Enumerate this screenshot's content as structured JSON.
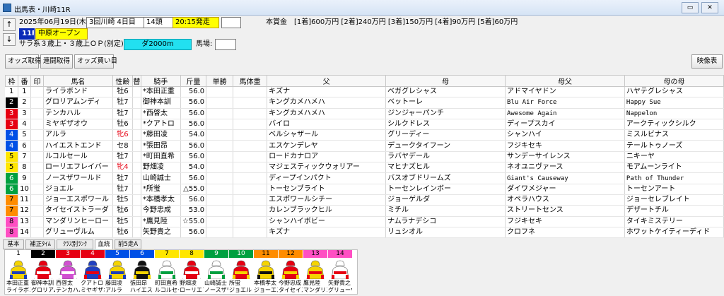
{
  "window": {
    "title": "出馬表・川崎11R",
    "minimize_label": "▭",
    "close_label": "✕"
  },
  "race": {
    "date": "2025年06月19日(木)",
    "meeting": "3回川崎 4日目",
    "runners": "14頭",
    "post_time": "20:15発走",
    "race_no": "11R",
    "race_name": "中原オープン",
    "conditions": "サラ系３歳上・３歳上ＯＰ(別定)",
    "course": "ダ2000m",
    "ground_label": "馬場:",
    "prize_label": "本賞金",
    "prizes": "[1着]600万円 [2着]240万円 [3着]150万円 [4着]90万円 [5着]60万円"
  },
  "toolbar": {
    "odds_fetch": "オッズ取得",
    "renraku_fetch": "連闘取得",
    "odds_buy": "オッズ買い目",
    "video": "映像表"
  },
  "table": {
    "headers": [
      "枠",
      "番",
      "印",
      "馬名",
      "性齢",
      "替",
      "騎手",
      "斤量",
      "単勝",
      "馬体重",
      "父",
      "母",
      "母父",
      "母の母"
    ],
    "rows": [
      {
        "waku": "1",
        "num": "1",
        "name": "ライラボンド",
        "sexage": "牡6",
        "change": "",
        "jockey": "*本田正重",
        "weight": "56.0",
        "sire": "キズナ",
        "dam": "ベガグレシャス",
        "damsire": "アドマイヤドン",
        "damdam": "ハヤテグレシャス"
      },
      {
        "waku": "2",
        "num": "2",
        "name": "グロリアムンディ",
        "sexage": "牡7",
        "change": "",
        "jockey": "御神本訓",
        "weight": "56.0",
        "sire": "キングカメハメハ",
        "dam": "ベットーレ",
        "damsire": "Blu Air Force",
        "damdam": "Happy Sue"
      },
      {
        "waku": "3",
        "num": "3",
        "name": "テンカハル",
        "sexage": "牡7",
        "change": "",
        "jockey": "*西啓太",
        "weight": "56.0",
        "sire": "キングカメハメハ",
        "dam": "ジンジャーパンチ",
        "damsire": "Awesome Again",
        "damdam": "Nappelon"
      },
      {
        "waku": "3",
        "num": "4",
        "name": "ミヤギザオウ",
        "sexage": "牡6",
        "change": "",
        "jockey": "*クアトロ",
        "weight": "56.0",
        "sire": "バイロ",
        "dam": "シルクドレス",
        "damsire": "ディープスカイ",
        "damdam": "アークティックシルク"
      },
      {
        "waku": "4",
        "num": "5",
        "name": "アルラ",
        "sexage": "牝6",
        "change": "",
        "jockey": "*藤田凌",
        "weight": "54.0",
        "sire": "ベルシャザール",
        "dam": "グリーディー",
        "damsire": "シャンハイ",
        "damdam": "ミスルビナス"
      },
      {
        "waku": "4",
        "num": "6",
        "name": "ハイエストエンド",
        "sexage": "セ8",
        "change": "",
        "jockey": "*張田昂",
        "weight": "56.0",
        "sire": "エスケンデレヤ",
        "dam": "デュークタイフーン",
        "damsire": "フジキセキ",
        "damdam": "テールトゥノーズ"
      },
      {
        "waku": "5",
        "num": "7",
        "name": "ルコルセール",
        "sexage": "牡7",
        "change": "",
        "jockey": "*町田直希",
        "weight": "56.0",
        "sire": "ロードカナロア",
        "dam": "ラバヤデール",
        "damsire": "サンデーサイレンス",
        "damdam": "ニキーヤ"
      },
      {
        "waku": "5",
        "num": "8",
        "name": "ローリエフレイバー",
        "sexage": "牝4",
        "change": "",
        "jockey": "野畑凌",
        "weight": "54.0",
        "sire": "マジェスティックウォリアー",
        "dam": "マヒナズヒル",
        "damsire": "ネオユニヴァース",
        "damdam": "モアムーンライト"
      },
      {
        "waku": "6",
        "num": "9",
        "name": "ノースザワールド",
        "sexage": "牡7",
        "change": "",
        "jockey": "山崎誠士",
        "weight": "56.0",
        "sire": "ディープインパクト",
        "dam": "バスオブドリームズ",
        "damsire": "Giant's Causeway",
        "damdam": "Path of Thunder"
      },
      {
        "waku": "6",
        "num": "10",
        "name": "ジョエル",
        "sexage": "牡7",
        "change": "",
        "jockey": "*所蛍",
        "weight": "△55.0",
        "sire": "トーセンブライト",
        "dam": "トーセンレインボー",
        "damsire": "ダイワメジャー",
        "damdam": "トーセンアート"
      },
      {
        "waku": "7",
        "num": "11",
        "name": "ジョーエスポワール",
        "sexage": "牡5",
        "change": "",
        "jockey": "*本橋孝太",
        "weight": "56.0",
        "sire": "エスポワールシチー",
        "dam": "ジョーゲルダ",
        "damsire": "オペラハウス",
        "damdam": "ジョーセレブレイト"
      },
      {
        "waku": "7",
        "num": "12",
        "name": "タイセイストラーダ",
        "sexage": "牡6",
        "change": "",
        "jockey": "今野忠成",
        "weight": "53.0",
        "sire": "カレンブラックヒル",
        "dam": "ミチル",
        "damsire": "ストリートセンス",
        "damdam": "デザートチル"
      },
      {
        "waku": "8",
        "num": "13",
        "name": "マンダリンヒーロー",
        "sexage": "牡5",
        "change": "",
        "jockey": "*鷹見陸",
        "weight": "☆55.0",
        "sire": "シャンハイボビー",
        "dam": "ナムラナデシコ",
        "damsire": "フジキセキ",
        "damdam": "タイキミステリー"
      },
      {
        "waku": "8",
        "num": "14",
        "name": "グリューヴルム",
        "sexage": "牡6",
        "change": "",
        "jockey": "矢野貴之",
        "weight": "56.0",
        "sire": "キズナ",
        "dam": "リュシオル",
        "damsire": "クロフネ",
        "damdam": "ホワットケイティーディド"
      }
    ]
  },
  "waku_colors": {
    "1": {
      "bg": "#ffffff",
      "fg": "#000000"
    },
    "2": {
      "bg": "#000000",
      "fg": "#ffffff"
    },
    "3": {
      "bg": "#e60012",
      "fg": "#ffffff"
    },
    "4": {
      "bg": "#0050e6",
      "fg": "#ffffff"
    },
    "5": {
      "bg": "#ffe600",
      "fg": "#000000"
    },
    "6": {
      "bg": "#00a040",
      "fg": "#ffffff"
    },
    "7": {
      "bg": "#ff8c00",
      "fg": "#000000"
    },
    "8": {
      "bg": "#ff4fc3",
      "fg": "#000000"
    }
  },
  "tabs": [
    "基本",
    "補正ﾀｲﾑ",
    "ｸﾗｽ別ﾗﾝｸ",
    "血統",
    "前5走A"
  ],
  "silks": [
    {
      "num": "1",
      "jockey": "本田正重",
      "horse": "ライラボンド",
      "colors": [
        "#f5d400",
        "#1e3fb8"
      ]
    },
    {
      "num": "2",
      "jockey": "御神本訓",
      "horse": "グロリアムンディ",
      "colors": [
        "#e60012",
        "#ffffff"
      ]
    },
    {
      "num": "3",
      "jockey": "西啓太",
      "horse": "テンカハル",
      "colors": [
        "#d14fd1",
        "#ffffff"
      ]
    },
    {
      "num": "4",
      "jockey": "クアトロ",
      "horse": "ミヤギザオウ",
      "colors": [
        "#2040c0",
        "#e60012"
      ]
    },
    {
      "num": "5",
      "jockey": "藤田凌",
      "horse": "アルラ",
      "colors": [
        "#f5d400",
        "#1e3fb8"
      ]
    },
    {
      "num": "6",
      "jockey": "張田昂",
      "horse": "ハイエストエンド",
      "colors": [
        "#111111",
        "#f5d400"
      ]
    },
    {
      "num": "7",
      "jockey": "町田直希",
      "horse": "ルコルセール",
      "colors": [
        "#ffffff",
        "#00a040"
      ]
    },
    {
      "num": "8",
      "jockey": "野畑凌",
      "horse": "ローリエフレイバー",
      "colors": [
        "#e60012",
        "#ffffff"
      ]
    },
    {
      "num": "9",
      "jockey": "山崎誠士",
      "horse": "ノースザワールド",
      "colors": [
        "#ffffff",
        "#00a040"
      ]
    },
    {
      "num": "10",
      "jockey": "所蛍",
      "horse": "ジョエル",
      "colors": [
        "#e60012",
        "#f5d400"
      ]
    },
    {
      "num": "11",
      "jockey": "本橋孝太",
      "horse": "ジョーエスポワール",
      "colors": [
        "#f5d400",
        "#111111"
      ]
    },
    {
      "num": "12",
      "jockey": "今野忠成",
      "horse": "タイセイストラーダ",
      "colors": [
        "#e60012",
        "#f5d400"
      ]
    },
    {
      "num": "13",
      "jockey": "鷹見陸",
      "horse": "マンダリンヒーロー",
      "colors": [
        "#f5d400",
        "#e60012"
      ]
    },
    {
      "num": "14",
      "jockey": "矢野貴之",
      "horse": "グリューヴルム",
      "colors": [
        "#ffffff",
        "#e60012"
      ]
    }
  ]
}
